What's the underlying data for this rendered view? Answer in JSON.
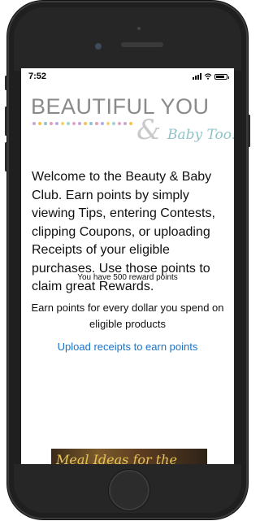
{
  "status_bar": {
    "time": "7:52",
    "battery_level": 0.85
  },
  "logo": {
    "title": "BEAUTIFUL YOU",
    "ampersand": "&",
    "subtitle": "Baby Too!",
    "trademark": "™"
  },
  "main": {
    "intro": "Welcome to the Beauty & Baby Club. Earn points by simply viewing Tips, entering Contests, clipping Coupons, or uploading Receipts of your eligible purchases. Use those points to claim great Rewards.",
    "points_text": "You have 500 reward points",
    "earn_text": "Earn points for every dollar you spend on eligible products",
    "upload_link": "Upload receipts to earn points",
    "banner_text": "Meal Ideas for the"
  },
  "colors": {
    "link": "#1a73c9",
    "dots": [
      "#c9a2d6",
      "#f2c14e",
      "#8fc3c9",
      "#e79ab5",
      "#b9a6e2",
      "#f5d26b",
      "#9fd0d6",
      "#e6a3c2"
    ]
  }
}
